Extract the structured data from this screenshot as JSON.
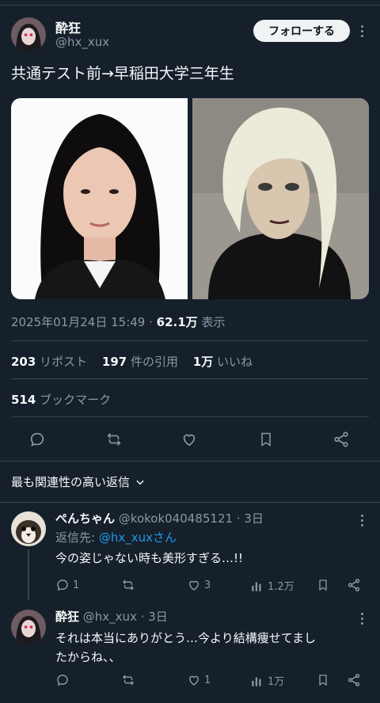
{
  "tweet": {
    "author_name": "酔狂",
    "author_handle": "@hx_xux",
    "follow_label": "フォローする",
    "text": "共通テスト前→早稲田大学三年生",
    "timestamp": "2025年01月24日 15:49",
    "views_count": "62.1万",
    "views_label": "表示",
    "reposts_count": "203",
    "reposts_label": "リポスト",
    "quotes_count": "197",
    "quotes_label": "件の引用",
    "likes_count": "1万",
    "likes_label": "いいね",
    "bookmarks_count": "514",
    "bookmarks_label": "ブックマーク"
  },
  "replies_sort_label": "最も関連性の高い返信",
  "replies": [
    {
      "name": "ぺんちゃん",
      "handle": "@kokok040485121",
      "time": "3日",
      "reply_to_prefix": "返信先: ",
      "reply_to_handle": "@hx_xux",
      "reply_to_suffix": "さん",
      "text": "今の姿じゃない時も美形すぎる…!!",
      "replies": "1",
      "retweets": "",
      "likes": "3",
      "views": "1.2万"
    },
    {
      "name": "酔狂",
      "handle": "@hx_xux",
      "time": "3日",
      "text_line1": "それは本当にありがとう…今より結構痩せてまし",
      "text_line2": "たからね、、",
      "replies": "",
      "retweets": "",
      "likes": "1",
      "views": "1万"
    }
  ],
  "colors": {
    "background": "#15202b",
    "text": "#f7f9f9",
    "muted": "#8b98a5",
    "link": "#1d9bf0",
    "divider": "#38444d"
  }
}
